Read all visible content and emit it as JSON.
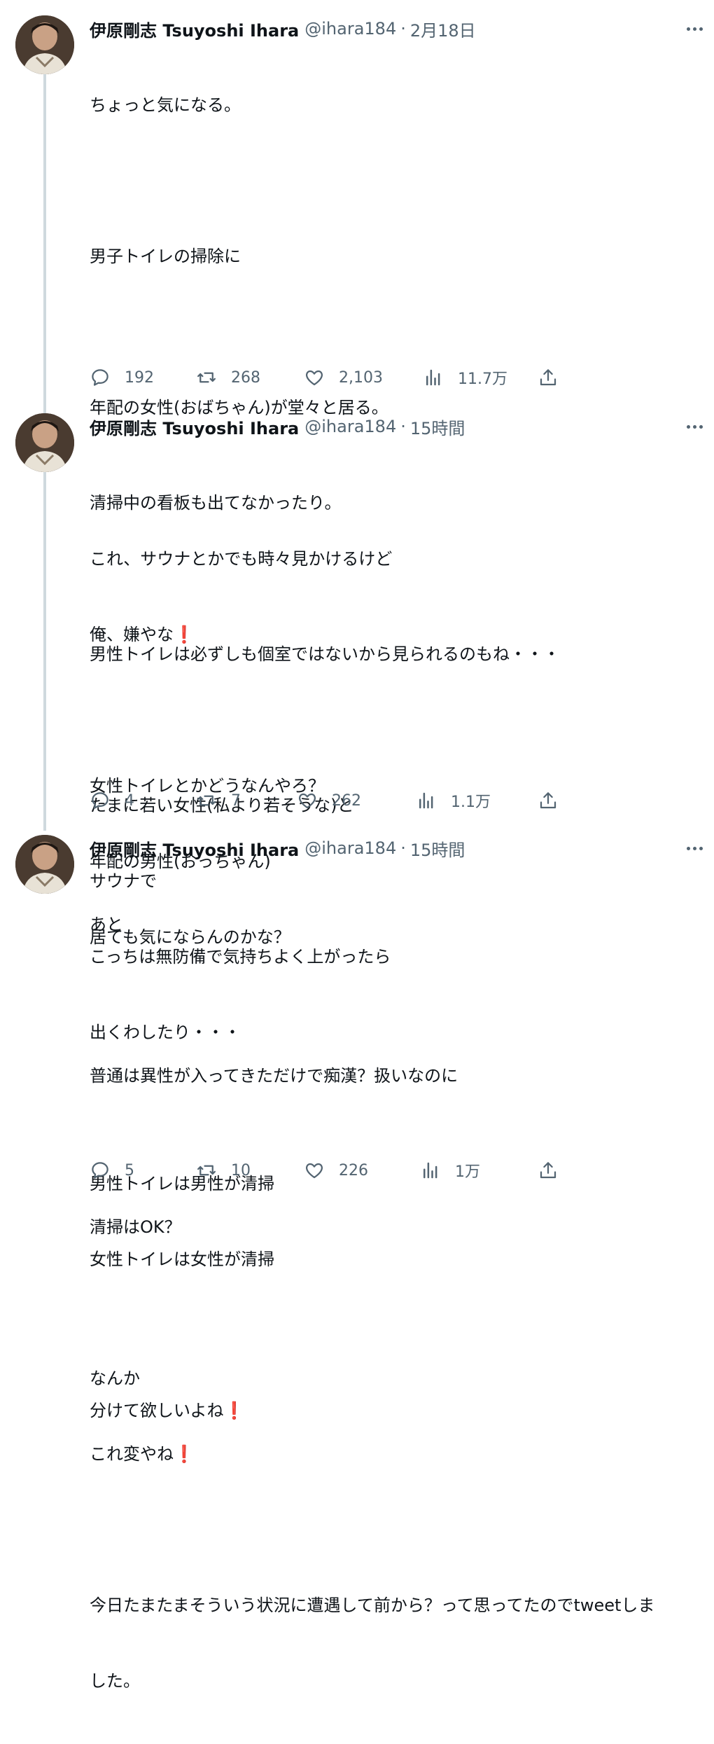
{
  "tweets": [
    {
      "author": {
        "name": "伊原剛志 Tsuyoshi Ihara",
        "handle": "@ihara184"
      },
      "time": "2月18日",
      "lines": [
        "ちょっと気になる。",
        "",
        "男子トイレの掃除に",
        "",
        "年配の女性(おばちゃん)が堂々と居る。",
        "",
        "これ、サウナとかでも時々見かけるけど",
        "俺、嫌やな❗",
        "",
        "女性トイレとかどうなんやろ？",
        "年配の男性(おっちゃん)",
        "居ても気にならんのかな？"
      ],
      "stats": {
        "replies": "192",
        "retweets": "268",
        "likes": "2,103",
        "views": "11.7万"
      }
    },
    {
      "author": {
        "name": "伊原剛志 Tsuyoshi Ihara",
        "handle": "@ihara184"
      },
      "time": "15時間",
      "lines": [
        "清掃中の看板も出てなかったり。",
        "",
        "男性トイレは必ずしも個室ではないから見られるのもね・・・",
        "",
        "たまに若い女性(私より若そうな)と",
        "サウナで",
        "こっちは無防備で気持ちよく上がったら",
        "出くわしたり・・・",
        "",
        "男性トイレは男性が清掃",
        "女性トイレは女性が清掃",
        "",
        "分けて欲しいよね❗"
      ],
      "stats": {
        "replies": "4",
        "retweets": "7",
        "likes": "262",
        "views": "1.1万"
      }
    },
    {
      "author": {
        "name": "伊原剛志 Tsuyoshi Ihara",
        "handle": "@ihara184"
      },
      "time": "15時間",
      "lines": [
        "あと",
        "",
        "普通は異性が入ってきただけで痴漢？扱いなのに",
        "",
        "清掃はOK？",
        "",
        "なんか",
        "これ変やね❗",
        "",
        "今日たまたまそういう状況に遭遇して前から？って思ってたのでtweetしま",
        "した。"
      ],
      "stats": {
        "replies": "5",
        "retweets": "10",
        "likes": "226",
        "views": "1万"
      }
    }
  ],
  "separator": "·",
  "icons": {
    "reply": "reply-icon",
    "retweet": "retweet-icon",
    "like": "heart-icon",
    "views": "analytics-icon",
    "share": "share-icon",
    "more": "more-icon"
  },
  "colors": {
    "text": "#0f1419",
    "secondary": "#536471",
    "thread_line": "#cfd9de",
    "exclamation": "#e0245e"
  }
}
